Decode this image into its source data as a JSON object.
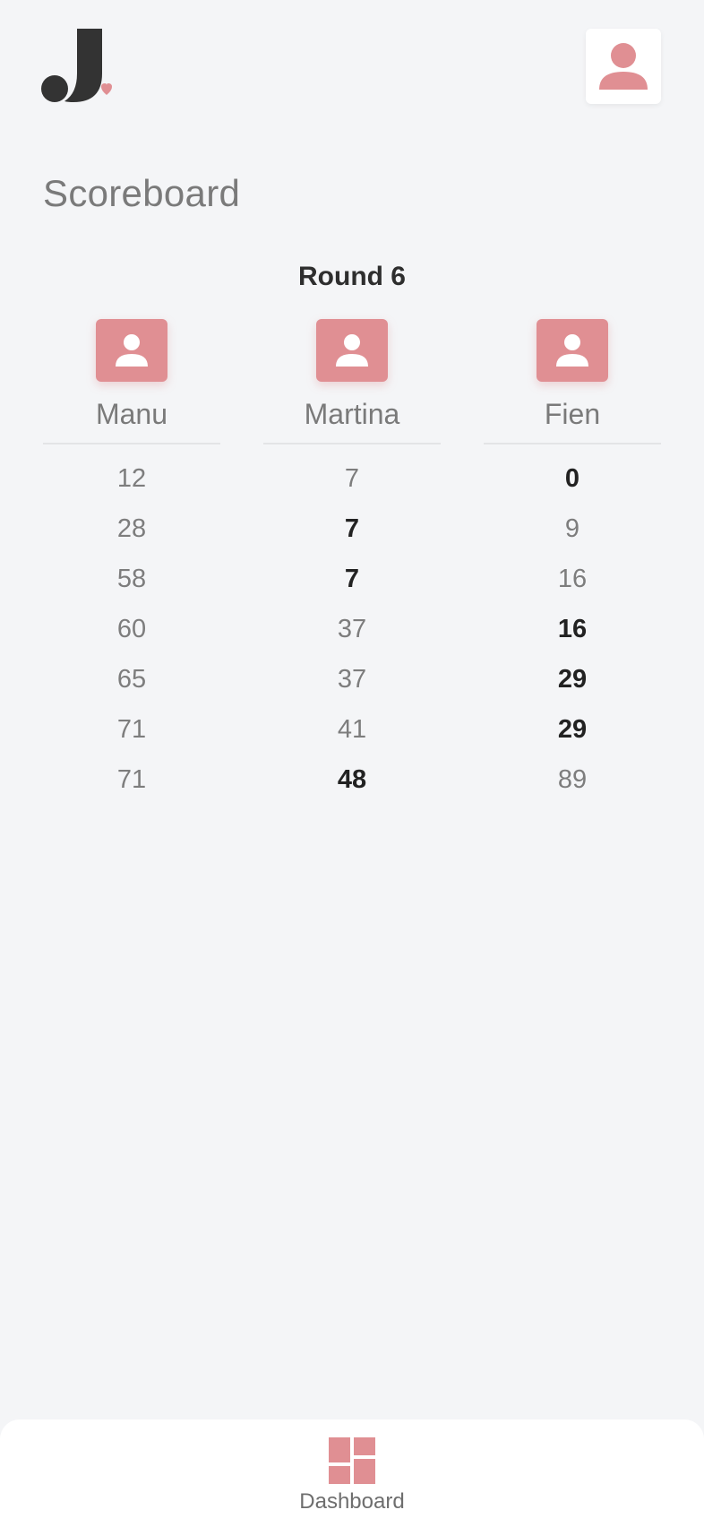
{
  "header": {
    "logo_icon": "j-heart-logo",
    "profile_icon": "user-icon"
  },
  "page": {
    "title": "Scoreboard",
    "round_label": "Round 6"
  },
  "players": [
    {
      "name": "Manu",
      "scores": [
        "12",
        "28",
        "58",
        "60",
        "65",
        "71",
        "71"
      ],
      "best": [
        false,
        false,
        false,
        false,
        false,
        false,
        false
      ]
    },
    {
      "name": "Martina",
      "scores": [
        "7",
        "7",
        "7",
        "37",
        "37",
        "41",
        "48"
      ],
      "best": [
        false,
        true,
        true,
        false,
        false,
        false,
        true
      ]
    },
    {
      "name": "Fien",
      "scores": [
        "0",
        "9",
        "16",
        "16",
        "29",
        "29",
        "89"
      ],
      "best": [
        true,
        false,
        false,
        true,
        true,
        true,
        false
      ]
    }
  ],
  "nav": {
    "dashboard_label": "Dashboard",
    "dashboard_icon": "dashboard-icon"
  },
  "colors": {
    "accent": "#e08f93",
    "background": "#f4f5f7",
    "text_muted": "#7a7a7a",
    "text_strong": "#222222"
  }
}
